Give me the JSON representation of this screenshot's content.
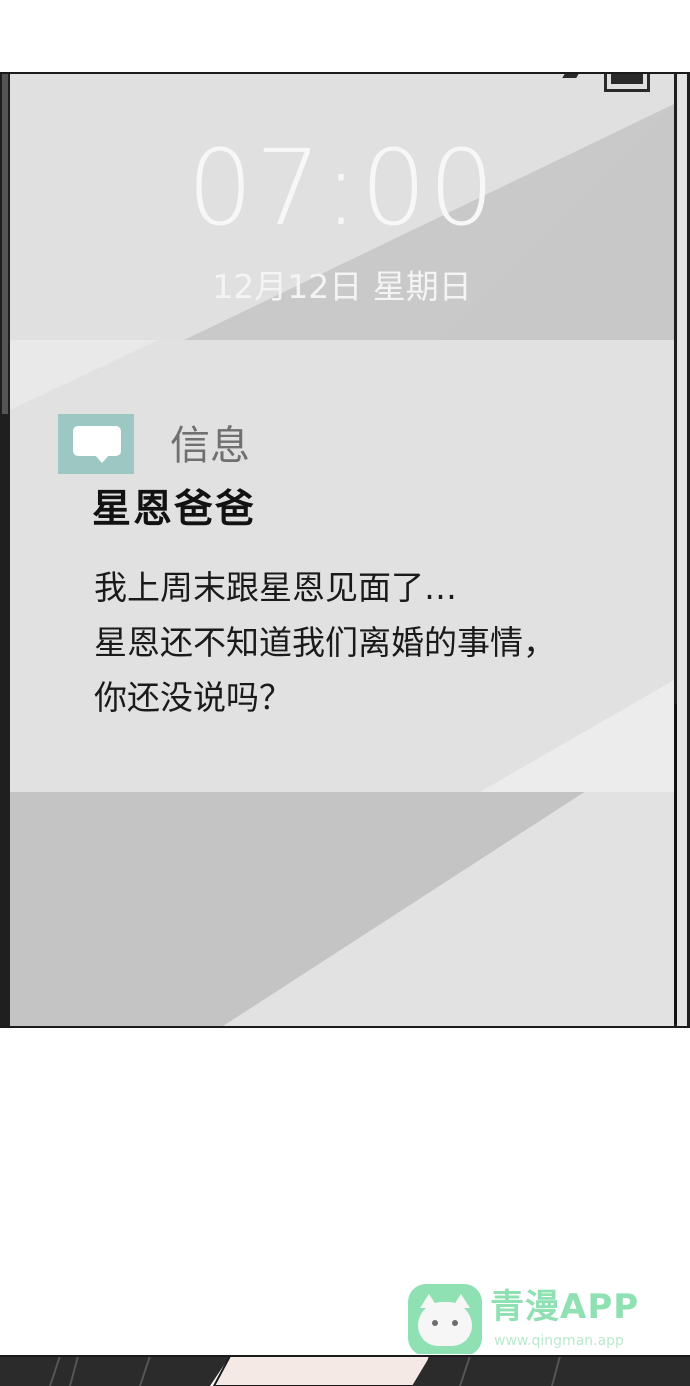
{
  "lock_screen": {
    "time": "07:00",
    "date": "12月12日 星期日",
    "status_icons": [
      "signal-icon",
      "battery-icon"
    ]
  },
  "notification": {
    "app_name": "信息",
    "app_icon": "message-bubble-icon",
    "app_icon_color": "#9cc7c3",
    "sender": "星恩爸爸",
    "message_lines": [
      "我上周末跟星恩见面了…",
      "星恩还不知道我们离婚的事情，",
      "你还没说吗？"
    ]
  },
  "watermark": {
    "title": "青漫APP",
    "url": "www.qingman.app",
    "color": "#8fe0b3",
    "logo": "cat-logo-icon"
  }
}
